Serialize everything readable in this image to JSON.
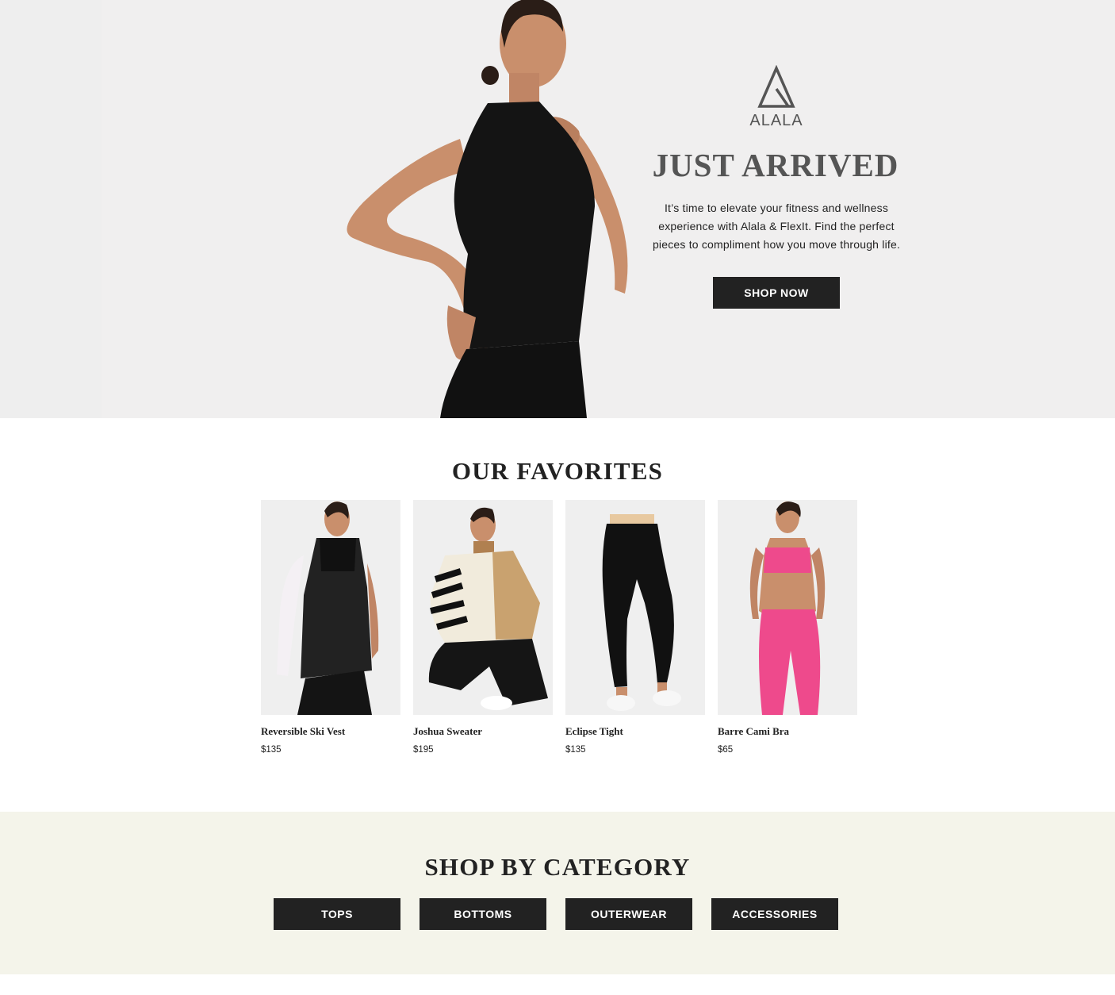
{
  "hero": {
    "brand": "ALALA",
    "title": "JUST ARRIVED",
    "text": "It’s time to elevate your fitness and wellness experience with Alala & FlexIt. Find the perfect pieces to compliment how you move through life.",
    "cta": "SHOP NOW"
  },
  "favorites": {
    "title": "OUR FAVORITES",
    "products": [
      {
        "name": "Reversible Ski Vest",
        "price": "$135"
      },
      {
        "name": "Joshua Sweater",
        "price": "$195"
      },
      {
        "name": "Eclipse Tight",
        "price": "$135"
      },
      {
        "name": "Barre Cami Bra",
        "price": "$65"
      }
    ]
  },
  "category": {
    "title": "SHOP BY CATEGORY",
    "buttons": [
      "TOPS",
      "BOTTOMS",
      "OUTERWEAR",
      "ACCESSORIES"
    ]
  },
  "colors": {
    "hero_bg": "#f0efef",
    "dark": "#222222",
    "category_bg": "#f4f4ea",
    "accent_pink": "#ee4a8c"
  }
}
